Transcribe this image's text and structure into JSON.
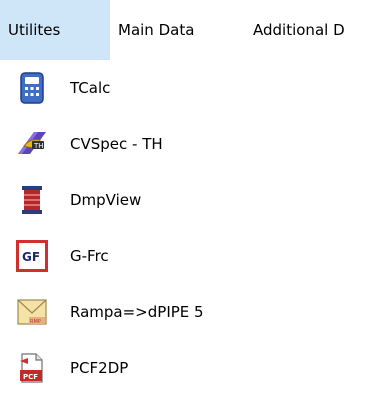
{
  "menubar": {
    "tabs": [
      {
        "label": "Utilites"
      },
      {
        "label": "Main Data"
      },
      {
        "label": "Additional D"
      }
    ]
  },
  "dropdown": {
    "items": [
      {
        "label": "TCalc",
        "icon": "calculator-icon"
      },
      {
        "label": "CVSpec - TH",
        "icon": "cvspec-icon"
      },
      {
        "label": "DmpView",
        "icon": "damper-icon"
      },
      {
        "label": "G-Frc",
        "icon": "gf-icon"
      },
      {
        "label": "Rampa=>dPIPE 5",
        "icon": "envelope-icon"
      },
      {
        "label": "PCF2DP",
        "icon": "pcf-icon"
      }
    ]
  },
  "colors": {
    "active_tab_bg": "#cfe6f8",
    "gf_border": "#d0302b"
  }
}
